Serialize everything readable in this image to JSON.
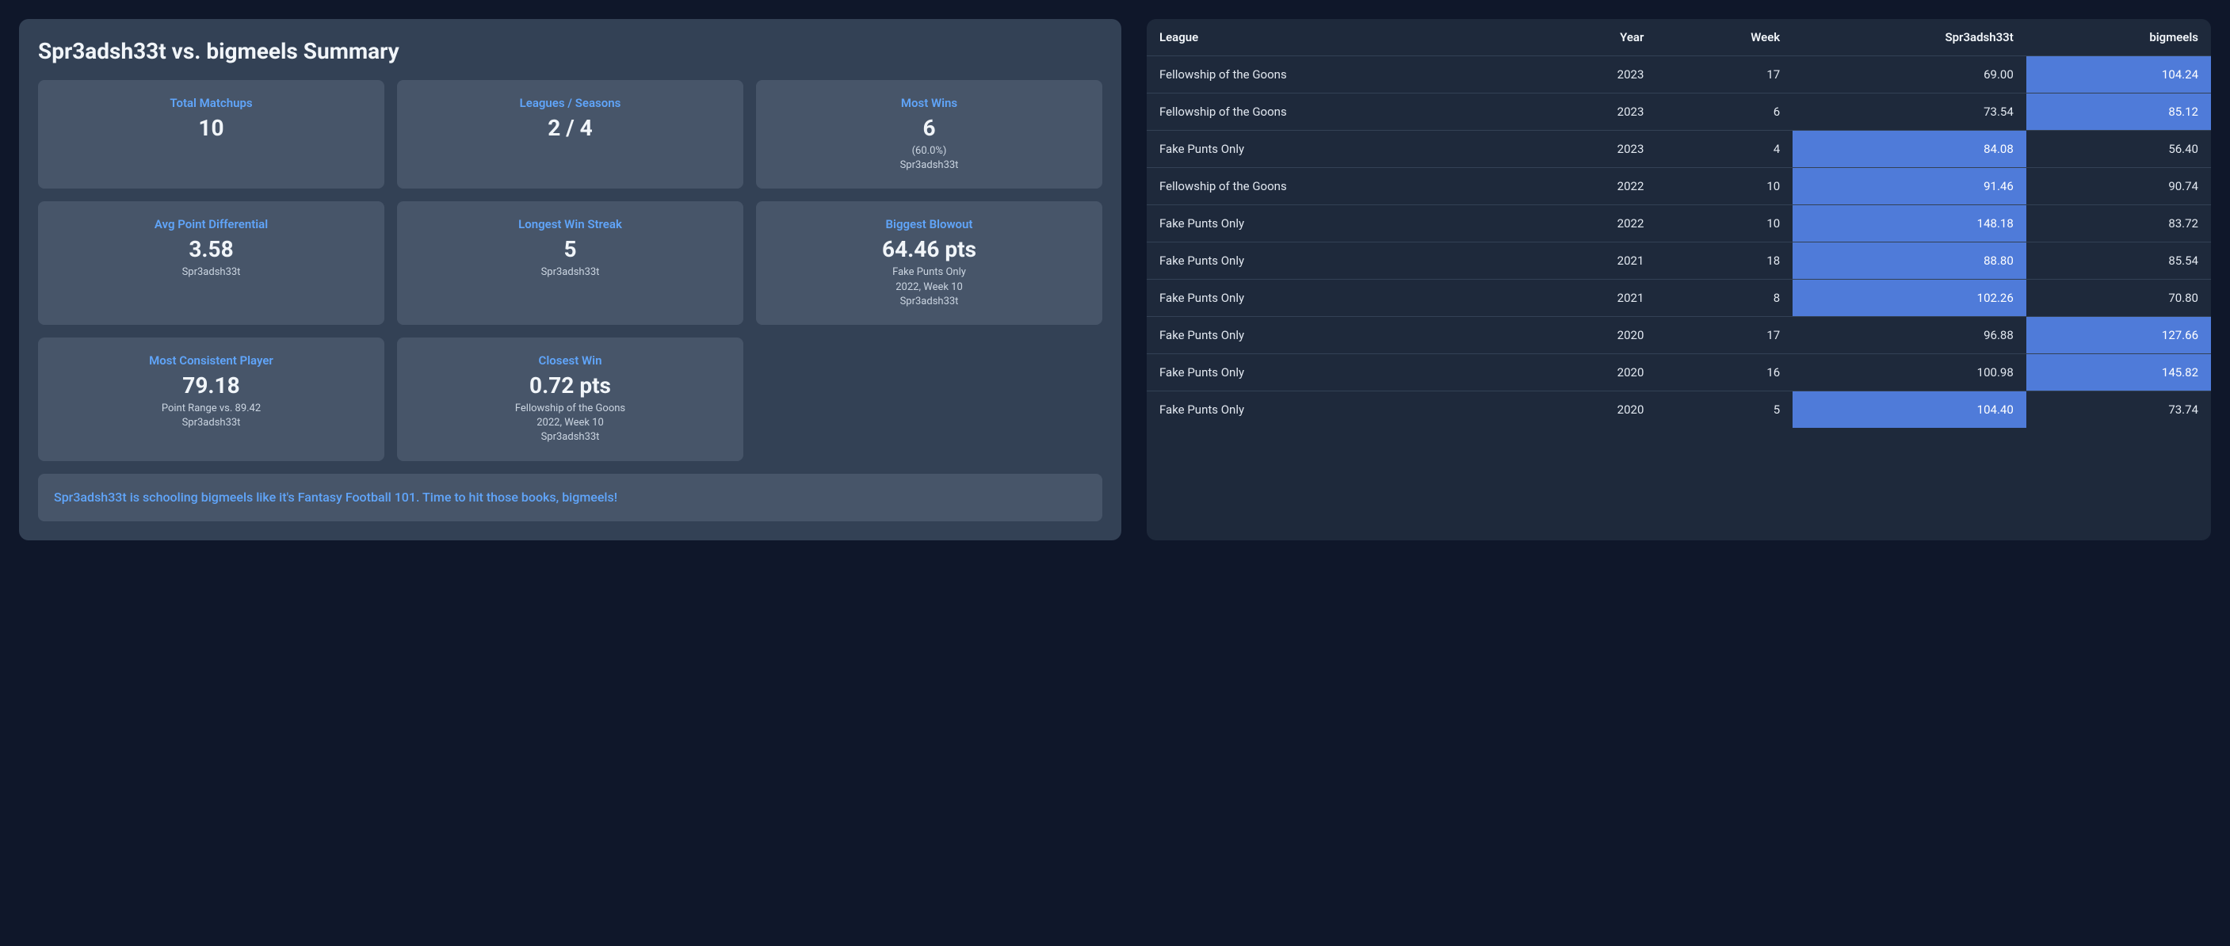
{
  "summary": {
    "title": "Spr3adsh33t vs. bigmeels Summary",
    "cards": [
      {
        "label": "Total Matchups",
        "value": "10",
        "subs": []
      },
      {
        "label": "Leagues / Seasons",
        "value": "2 / 4",
        "subs": []
      },
      {
        "label": "Most Wins",
        "value": "6",
        "subs": [
          "(60.0%)",
          "Spr3adsh33t"
        ]
      },
      {
        "label": "Avg Point Differential",
        "value": "3.58",
        "subs": [
          "Spr3adsh33t"
        ]
      },
      {
        "label": "Longest Win Streak",
        "value": "5",
        "subs": [
          "Spr3adsh33t"
        ]
      },
      {
        "label": "Biggest Blowout",
        "value": "64.46 pts",
        "subs": [
          "Fake Punts Only",
          "2022, Week 10",
          "Spr3adsh33t"
        ]
      },
      {
        "label": "Most Consistent Player",
        "value": "79.18",
        "subs": [
          "Point Range vs. 89.42",
          "Spr3adsh33t"
        ]
      },
      {
        "label": "Closest Win",
        "value": "0.72 pts",
        "subs": [
          "Fellowship of the Goons",
          "2022, Week 10",
          "Spr3adsh33t"
        ]
      }
    ],
    "message": "Spr3adsh33t is schooling bigmeels like it's Fantasy Football 101. Time to hit those books, bigmeels!"
  },
  "table": {
    "headers": [
      "League",
      "Year",
      "Week",
      "Spr3adsh33t",
      "bigmeels"
    ],
    "rows": [
      {
        "league": "Fellowship of the Goons",
        "year": "2023",
        "week": "17",
        "p1": "69.00",
        "p2": "104.24",
        "winner": 2
      },
      {
        "league": "Fellowship of the Goons",
        "year": "2023",
        "week": "6",
        "p1": "73.54",
        "p2": "85.12",
        "winner": 2
      },
      {
        "league": "Fake Punts Only",
        "year": "2023",
        "week": "4",
        "p1": "84.08",
        "p2": "56.40",
        "winner": 1
      },
      {
        "league": "Fellowship of the Goons",
        "year": "2022",
        "week": "10",
        "p1": "91.46",
        "p2": "90.74",
        "winner": 1
      },
      {
        "league": "Fake Punts Only",
        "year": "2022",
        "week": "10",
        "p1": "148.18",
        "p2": "83.72",
        "winner": 1
      },
      {
        "league": "Fake Punts Only",
        "year": "2021",
        "week": "18",
        "p1": "88.80",
        "p2": "85.54",
        "winner": 1
      },
      {
        "league": "Fake Punts Only",
        "year": "2021",
        "week": "8",
        "p1": "102.26",
        "p2": "70.80",
        "winner": 1
      },
      {
        "league": "Fake Punts Only",
        "year": "2020",
        "week": "17",
        "p1": "96.88",
        "p2": "127.66",
        "winner": 2
      },
      {
        "league": "Fake Punts Only",
        "year": "2020",
        "week": "16",
        "p1": "100.98",
        "p2": "145.82",
        "winner": 2
      },
      {
        "league": "Fake Punts Only",
        "year": "2020",
        "week": "5",
        "p1": "104.40",
        "p2": "73.74",
        "winner": 1
      }
    ]
  }
}
